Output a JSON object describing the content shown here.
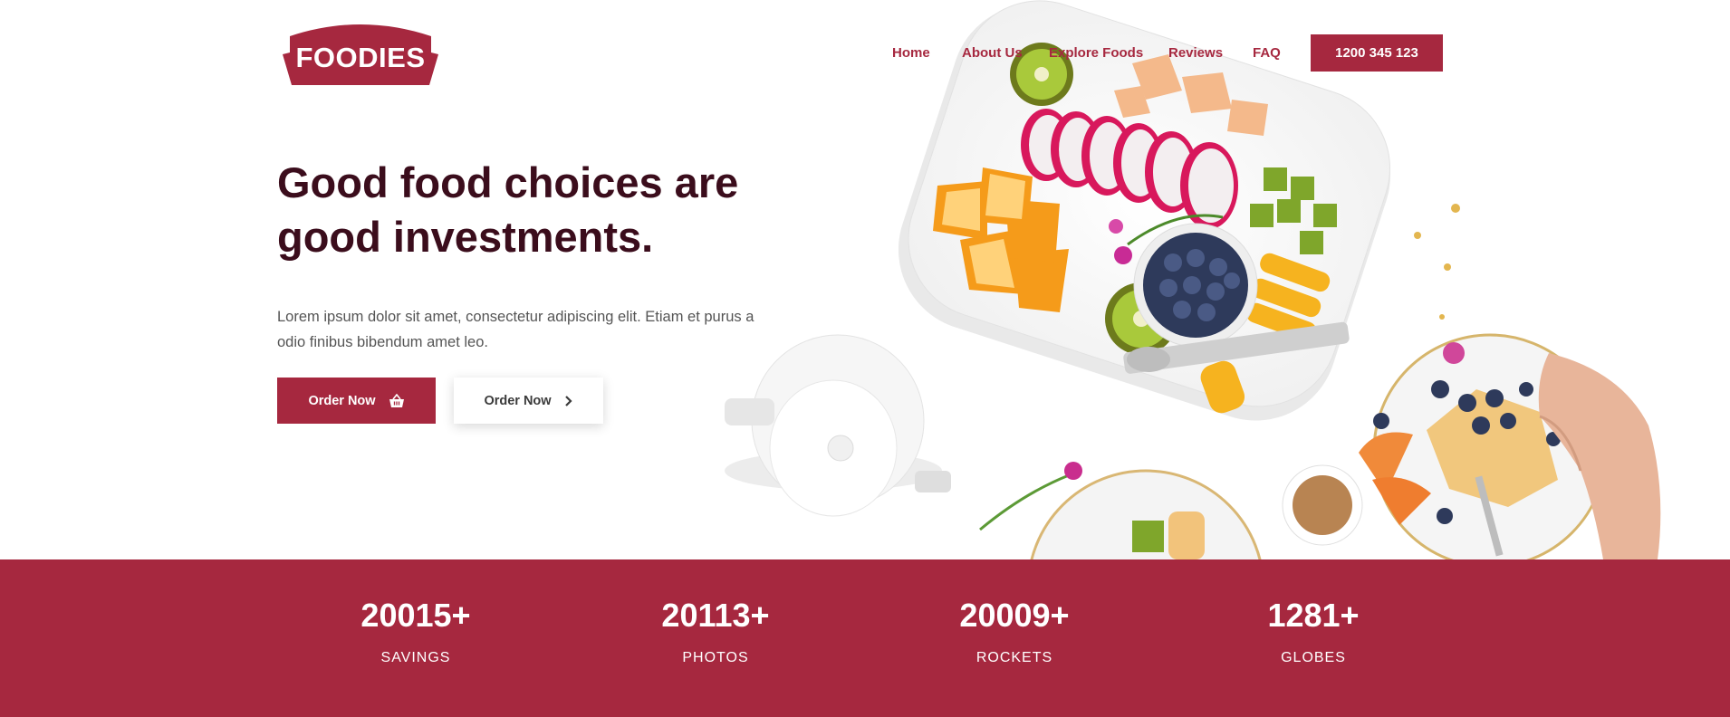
{
  "brand": {
    "logo_text": "FOODIES",
    "color": "#a6283f",
    "dark_text": "#3b0d1c"
  },
  "nav": {
    "items": [
      "Home",
      "About Us",
      "Explore Foods",
      "Reviews",
      "FAQ"
    ],
    "phone": "1200 345 123"
  },
  "hero": {
    "headline_line1": "Good food choices are",
    "headline_line2": "good investments.",
    "description": "Lorem ipsum dolor sit amet, consectetur adipiscing elit. Etiam et purus a odio finibus bibendum amet leo.",
    "primary_button": {
      "label": "Order Now",
      "icon": "basket-icon"
    },
    "secondary_button": {
      "label": "Order Now",
      "icon": "chevron-right-icon"
    }
  },
  "stats": [
    {
      "value": "20015+",
      "label": "SAVINGS"
    },
    {
      "value": "20113+",
      "label": "PHOTOS"
    },
    {
      "value": "20009+",
      "label": "ROCKETS"
    },
    {
      "value": "1281+",
      "label": "GLOBES"
    }
  ]
}
